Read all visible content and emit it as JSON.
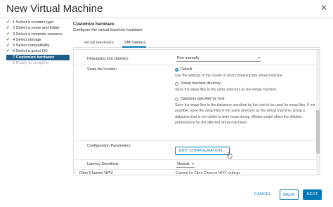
{
  "window": {
    "title": "New Virtual Machine",
    "close_glyph": "✕"
  },
  "steps": [
    {
      "label": "1 Select a creation type",
      "state": "done"
    },
    {
      "label": "2 Select a name and folder",
      "state": "done"
    },
    {
      "label": "3 Select a compute resource",
      "state": "done"
    },
    {
      "label": "4 Select storage",
      "state": "done"
    },
    {
      "label": "5 Select compatibility",
      "state": "done"
    },
    {
      "label": "6 Select a guest OS",
      "state": "done"
    },
    {
      "label": "7 Customize hardware",
      "state": "active"
    },
    {
      "label": "8 Ready to complete",
      "state": "disabled"
    }
  ],
  "check_glyph": "✔",
  "header": {
    "title": "Customize hardware",
    "subtitle": "Configure the virtual machine hardware"
  },
  "tabs": {
    "virtual_hardware": "Virtual Hardware",
    "vm_options": "VM Options"
  },
  "options": {
    "debugging": {
      "label": "Debugging and statistics",
      "value": "Run normally"
    },
    "swap": {
      "label": "Swap file location",
      "default_label": "Default",
      "default_desc": "Use the settings of the cluster or host containing the virtual machine.",
      "vm_dir_label": "Virtual machine directory",
      "vm_dir_desc": "Store the swap files in the same directory as the virtual machine.",
      "datastore_label": "Datastore specified by host",
      "datastore_desc": "Store the swap files in the datastore specified by the host to be used for swap files. If not possible, store the swap files in the same directory as the virtual machine. Using a datastore that is not visible to both hosts during vMotion might affect the vMotion performance for the affected virtual machines."
    },
    "config_params": {
      "label": "Configuration Parameters",
      "button": "EDIT CONFIGURATION..."
    },
    "latency": {
      "label": "Latency Sensitivity",
      "value": "Normal"
    },
    "fibre": {
      "label": "Fibre Channel NPIV",
      "desc": "Expand for Fibre Channel NPIV settings"
    }
  },
  "footer": {
    "cancel": "CANCEL",
    "back": "BACK",
    "next": "NEXT"
  }
}
